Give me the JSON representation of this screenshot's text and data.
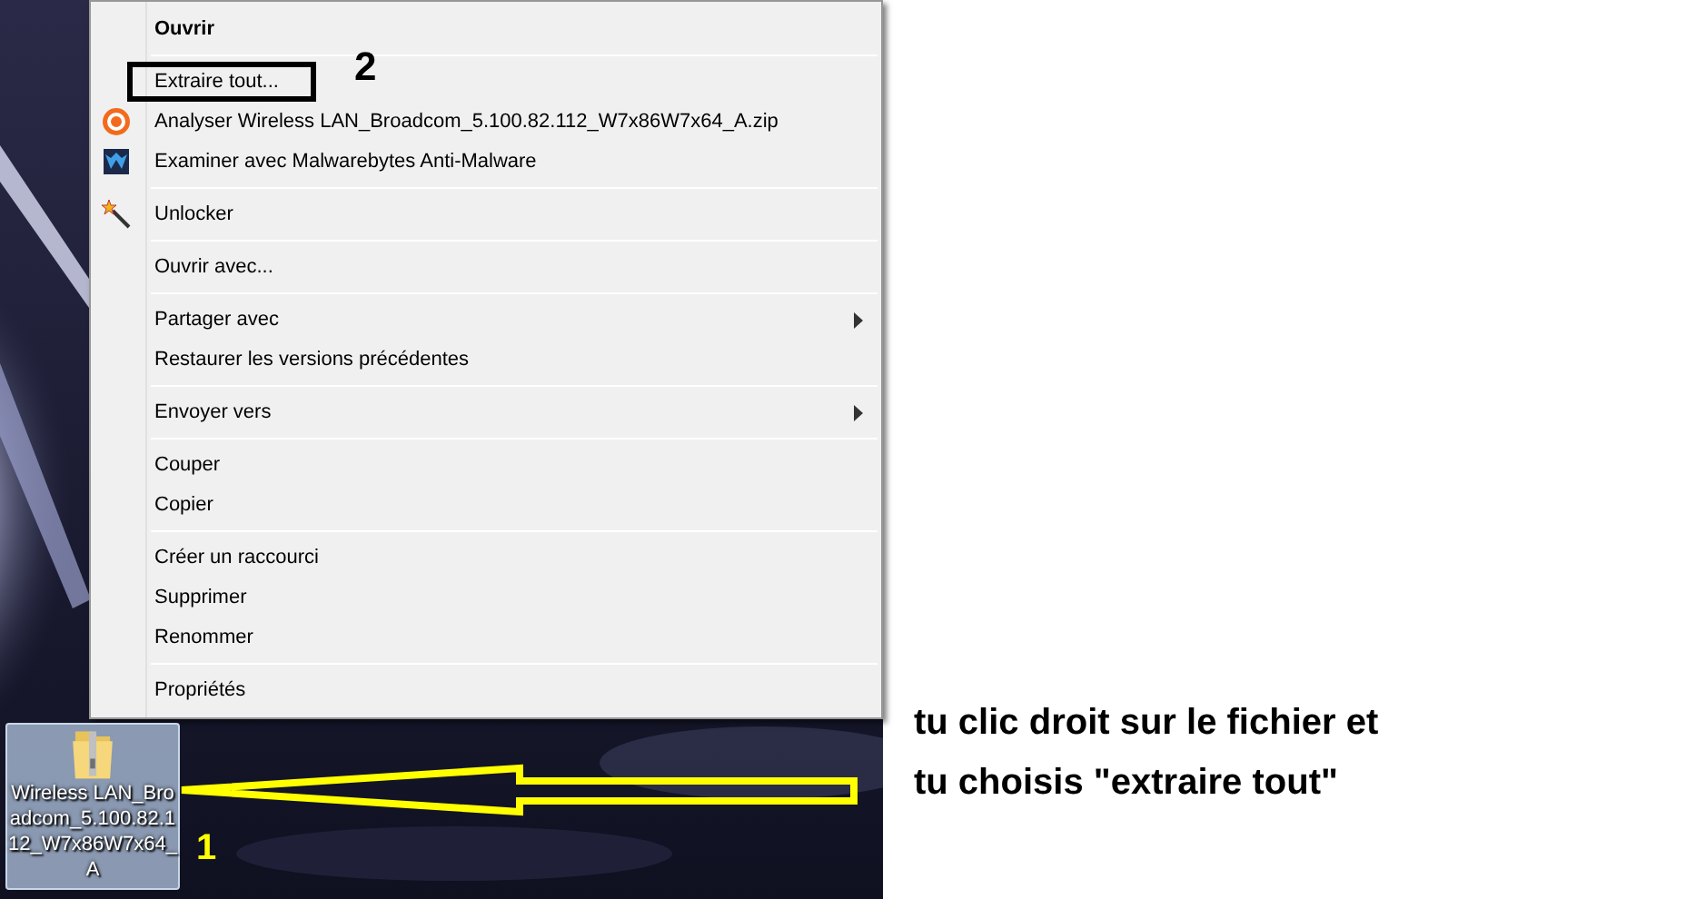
{
  "context_menu": {
    "groups": [
      [
        {
          "label": "Ouvrir",
          "bold": true,
          "kind": "plain",
          "submenu": false
        }
      ],
      [
        {
          "label": "Extraire tout...",
          "bold": false,
          "kind": "plain",
          "submenu": false,
          "outlined": true
        },
        {
          "label": "Analyser Wireless LAN_Broadcom_5.100.82.112_W7x86W7x64_A.zip",
          "bold": false,
          "kind": "antivirus",
          "submenu": false
        },
        {
          "label": "Examiner avec Malwarebytes Anti-Malware",
          "bold": false,
          "kind": "malware",
          "submenu": false
        }
      ],
      [
        {
          "label": "Unlocker",
          "bold": false,
          "kind": "wand",
          "submenu": false
        }
      ],
      [
        {
          "label": "Ouvrir avec...",
          "bold": false,
          "kind": "plain",
          "submenu": false
        }
      ],
      [
        {
          "label": "Partager avec",
          "bold": false,
          "kind": "plain",
          "submenu": true
        },
        {
          "label": "Restaurer les versions précédentes",
          "bold": false,
          "kind": "plain",
          "submenu": false
        }
      ],
      [
        {
          "label": "Envoyer vers",
          "bold": false,
          "kind": "plain",
          "submenu": true
        }
      ],
      [
        {
          "label": "Couper",
          "bold": false,
          "kind": "plain",
          "submenu": false
        },
        {
          "label": "Copier",
          "bold": false,
          "kind": "plain",
          "submenu": false
        }
      ],
      [
        {
          "label": "Créer un raccourci",
          "bold": false,
          "kind": "plain",
          "submenu": false
        },
        {
          "label": "Supprimer",
          "bold": false,
          "kind": "plain",
          "submenu": false
        },
        {
          "label": "Renommer",
          "bold": false,
          "kind": "plain",
          "submenu": false
        }
      ],
      [
        {
          "label": "Propriétés",
          "bold": false,
          "kind": "plain",
          "submenu": false
        }
      ]
    ]
  },
  "desktop_file": {
    "label": "Wireless LAN_Broadcom_5.100.82.112_W7x86W7x64_A",
    "selected": true
  },
  "annotations": {
    "step_1": "1",
    "step_2": "2",
    "instruction": "tu clic droit sur le fichier et tu choisis \"extraire tout\""
  }
}
